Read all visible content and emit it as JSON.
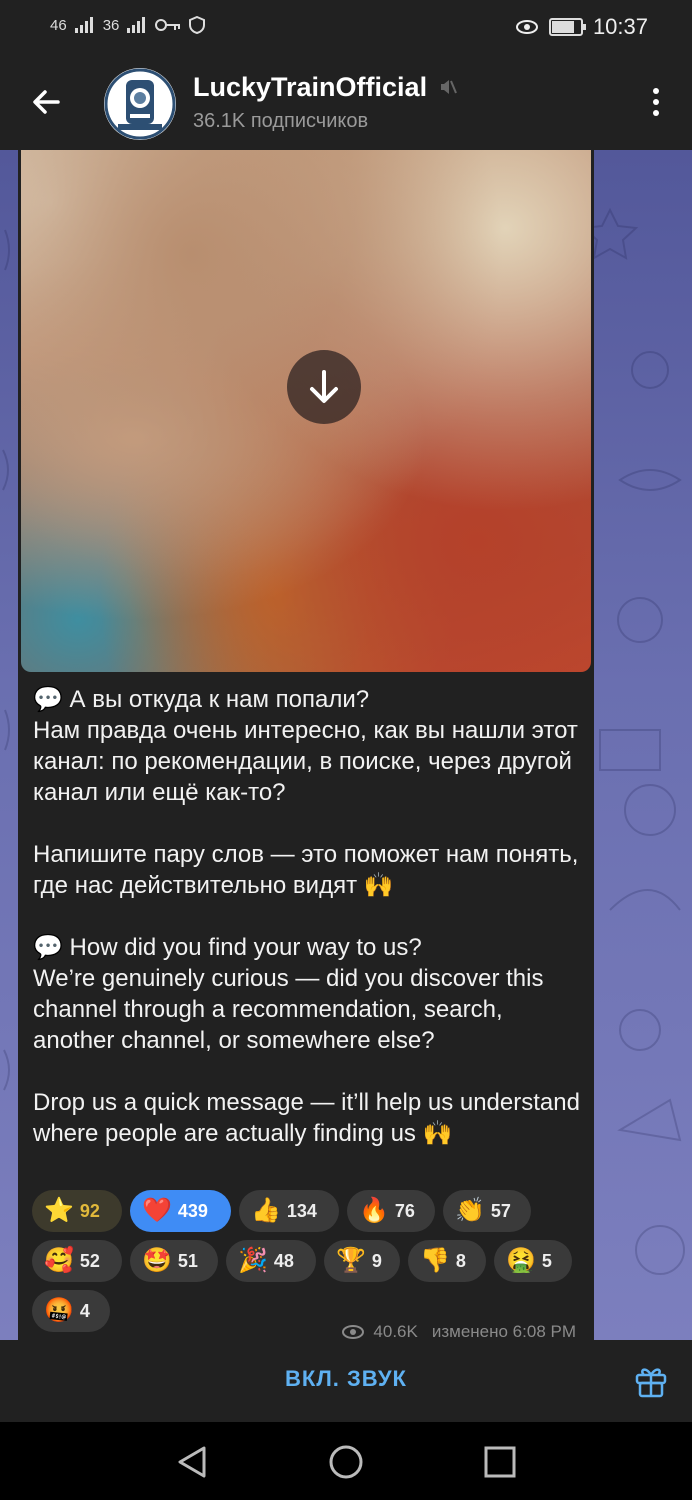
{
  "status_bar": {
    "signal1": "46",
    "signal2": "36",
    "time": "10:37"
  },
  "header": {
    "back_icon": "arrow-left-icon",
    "channel_name": "LuckyTrainOfficial",
    "subscribers": "36.1K подписчиков",
    "mute_icon": "muted-speaker-icon",
    "menu_icon": "more-vertical-icon"
  },
  "post": {
    "media_action_icon": "download-arrow-icon",
    "text": "💬 А вы откуда к нам попали?\nНам правда очень интересно, как вы нашли этот канал: по рекомендации, в поиске, через другой канал или ещё как-то?\n\nНапишите пару слов — это поможет нам понять, где нас действительно видят 🙌\n\n💬 How did you find your way to us?\nWe’re genuinely curious — did you discover this channel through a recommendation, search, another channel, or somewhere else?\n\nDrop us a quick message — it’ll help us understand where people are actually finding us 🙌",
    "reactions": [
      {
        "emoji": "⭐",
        "count": "92"
      },
      {
        "emoji": "❤️",
        "count": "439"
      },
      {
        "emoji": "👍",
        "count": "134"
      },
      {
        "emoji": "🔥",
        "count": "76"
      },
      {
        "emoji": "👏",
        "count": "57"
      },
      {
        "emoji": "🥰",
        "count": "52"
      },
      {
        "emoji": "🤩",
        "count": "51"
      },
      {
        "emoji": "🎉",
        "count": "48"
      },
      {
        "emoji": "🏆",
        "count": "9"
      },
      {
        "emoji": "👎",
        "count": "8"
      },
      {
        "emoji": "🤮",
        "count": "5"
      },
      {
        "emoji": "🤬",
        "count": "4"
      }
    ],
    "views": "40.6K",
    "edited": "изменено 6:08 PM"
  },
  "bottom_bar": {
    "unmute_label": "ВКЛ. ЗВУК",
    "gift_icon": "gift-icon"
  },
  "colors": {
    "accent": "#5fb1f2",
    "heart_reaction": "#3f8cf5",
    "bubble": "#212121"
  }
}
